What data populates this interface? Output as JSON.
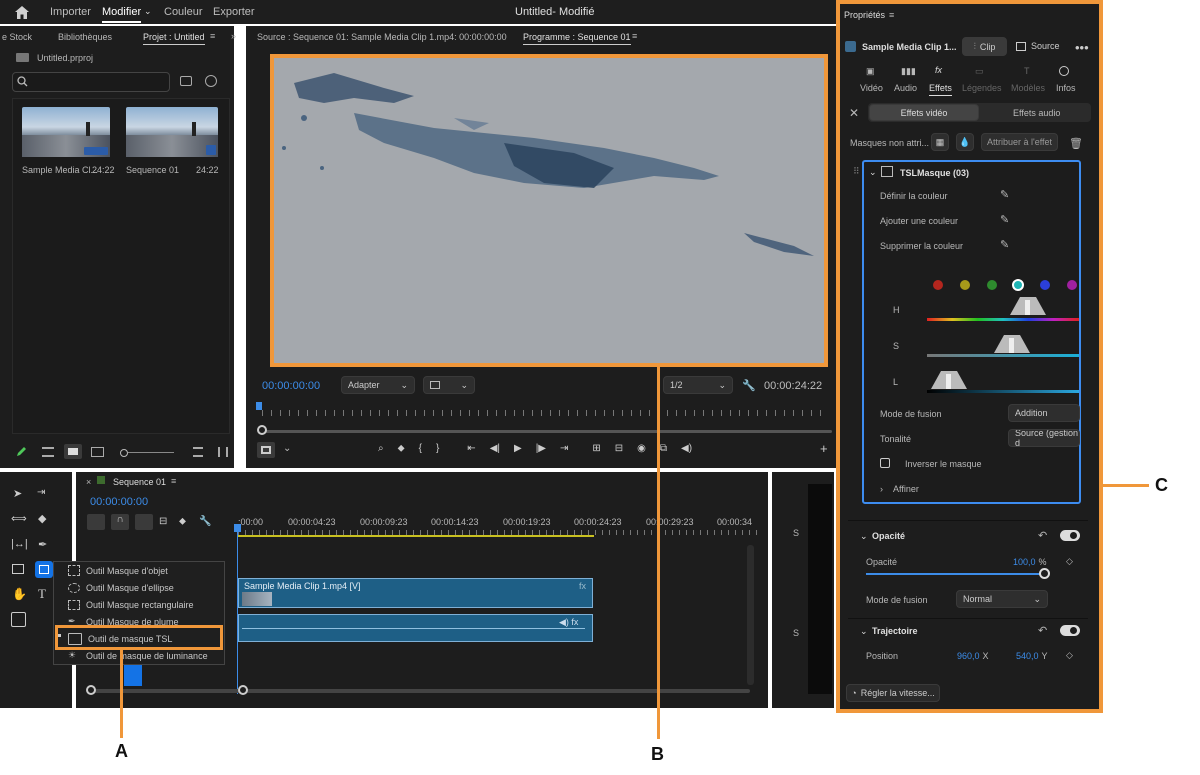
{
  "menu": {
    "items": [
      "Importer",
      "Modifier",
      "Couleur",
      "Exporter"
    ],
    "title": "Untitled",
    "status": " - Modifié"
  },
  "project": {
    "tabs": [
      "e Stock",
      "Bibliothèques",
      "Projet : Untitled"
    ],
    "file": "Untitled.prproj",
    "items": [
      {
        "name": "Sample Media Cl...",
        "duration": "24:22"
      },
      {
        "name": "Sequence 01",
        "duration": "24:22"
      }
    ]
  },
  "monitor": {
    "source_tab": "Source : Sequence 01: Sample Media Clip 1.mp4: 00:00:00:00",
    "program_tab": "Programme : Sequence 01",
    "timecode_in": "00:00:00:00",
    "fit": "Adapter",
    "resolution": "1/2",
    "timecode_out": "00:00:24:22"
  },
  "timeline": {
    "tab": "Sequence 01",
    "timecode": "00:00:00:00",
    "ruler": [
      ":00:00",
      "00:00:04:23",
      "00:00:09:23",
      "00:00:14:23",
      "00:00:19:23",
      "00:00:24:23",
      "00:00:29:23",
      "00:00:34"
    ],
    "clip": "Sample Media Clip 1.mp4 [V]"
  },
  "mask_menu": {
    "items": [
      "Outil Masque d'objet",
      "Outil Masque d'ellipse",
      "Outil Masque rectangulaire",
      "Outil Masque de plume",
      "Outil de masque TSL",
      "Outil de masque de luminance"
    ]
  },
  "properties": {
    "title": "Propriétés",
    "clip_name": "Sample Media Clip 1...",
    "clip_btn": "Clip",
    "source_btn": "Source",
    "tabs": [
      "Vidéo",
      "Audio",
      "Effets",
      "Légendes",
      "Modèles",
      "Infos"
    ],
    "effects_video": "Effets vidéo",
    "effects_audio": "Effets audio",
    "masks_label": "Masques non attri...",
    "assign_btn": "Attribuer à l'effet",
    "mask_name": "TSLMasque (03)",
    "define_color": "Définir la couleur",
    "add_color": "Ajouter une couleur",
    "remove_color": "Supprimer la couleur",
    "h": "H",
    "s": "S",
    "l": "L",
    "blend_mode_label": "Mode de fusion",
    "blend_mode_value": "Addition",
    "tonality_label": "Tonalité",
    "tonality_value": "Source (gestion d",
    "invert": "Inverser le masque",
    "refine": "Affiner",
    "opacity_section": "Opacité",
    "opacity_label": "Opacité",
    "opacity_value": "100,0",
    "opacity_unit": "%",
    "blend2_label": "Mode de fusion",
    "blend2_value": "Normal",
    "trajectory": "Trajectoire",
    "position_label": "Position",
    "pos_x": "960,0",
    "x_unit": "X",
    "pos_y": "540,0",
    "y_unit": "Y",
    "speed_btn": "Régler la vitesse..."
  },
  "swatches": [
    "#b3261e",
    "#a89a1a",
    "#2e8b2e",
    "#1fb5b5",
    "#2b3fd9",
    "#a020a0"
  ],
  "callouts": {
    "a": "A",
    "b": "B",
    "c": "C"
  }
}
